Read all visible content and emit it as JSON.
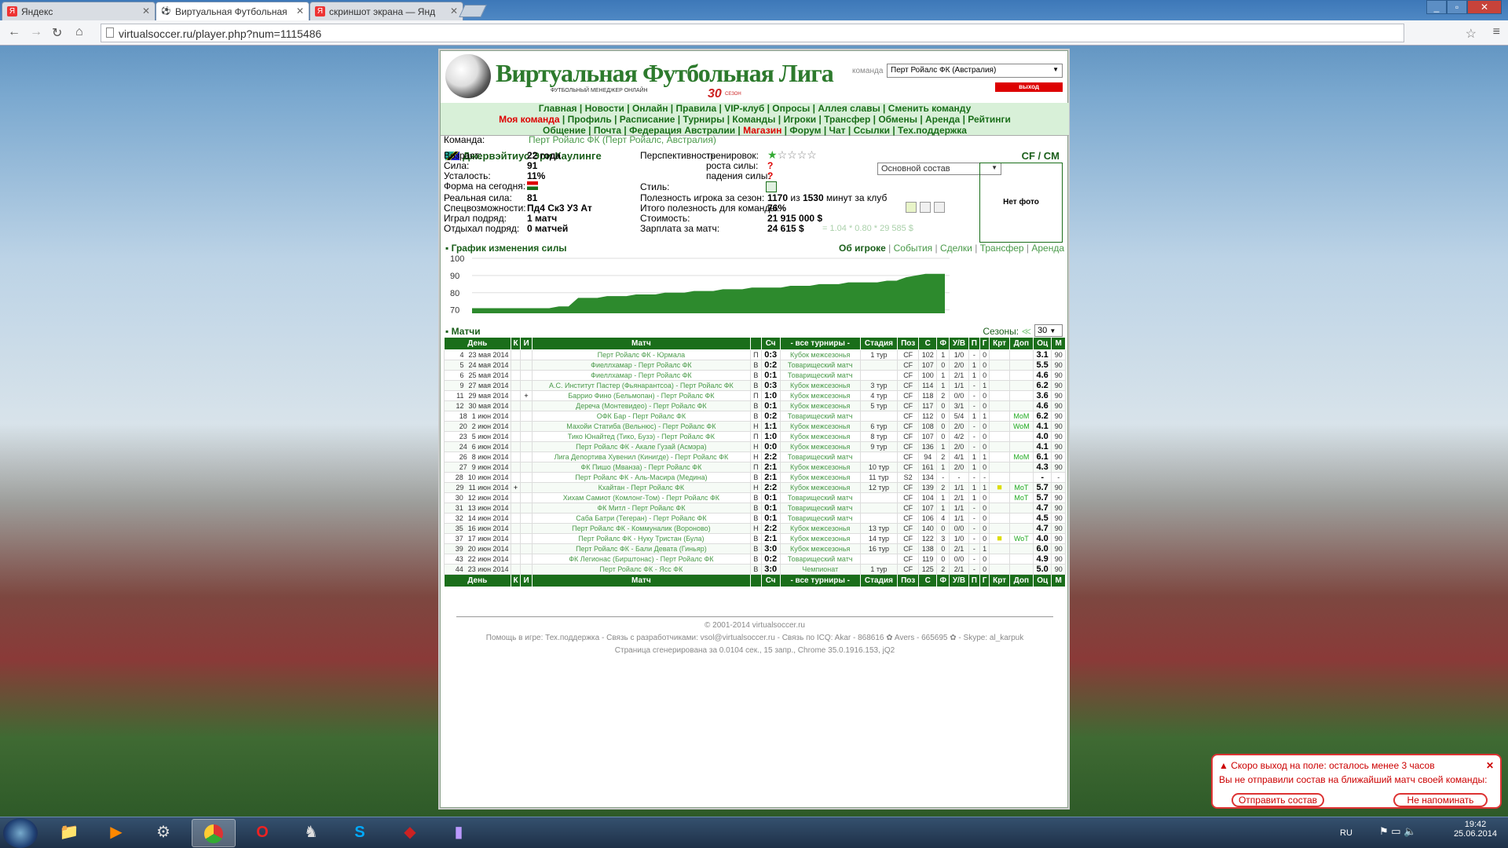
{
  "browser": {
    "tabs": [
      {
        "title": "Яндекс",
        "fav": "Я"
      },
      {
        "title": "Виртуальная Футбольная",
        "fav": "⚽"
      },
      {
        "title": "скриншот экрана — Янд",
        "fav": "Я"
      }
    ],
    "url": "virtualsoccer.ru/player.php?num=1115486"
  },
  "site": {
    "name": "Виртуальная Футбольная Лига",
    "tagline": "ФУТБОЛЬНЫЙ МЕНЕДЖЕР ОНЛАЙН",
    "season": "30",
    "season_label": "СЕЗОН",
    "team_label": "команда",
    "team_value": "Перт Ройалс ФК (Австралия)",
    "logout": "выход"
  },
  "nav": {
    "row1": [
      "Главная",
      "Новости",
      "Онлайн",
      "Правила",
      "VIP-клуб",
      "Опросы",
      "Аллея славы",
      "Сменить команду"
    ],
    "row2": [
      "Моя команда",
      "Профиль",
      "Расписание",
      "Турниры",
      "Команды",
      "Игроки",
      "Трансфер",
      "Обмены",
      "Аренда",
      "Рейтинги"
    ],
    "row3": [
      "Общение",
      "Почта",
      "Федерация Австралии",
      "Магазин",
      "Форум",
      "Чат",
      "Ссылки",
      "Тех.поддержка"
    ]
  },
  "player": {
    "name": "Джервэйтиус Эри Каулинге",
    "position": "CF / CM",
    "team_label": "Команда:",
    "team": "Перт Ройалс ФК (Перт Ройалс, Австралия)",
    "squad": "Основной состав",
    "photo": "Нет фото",
    "age_l": "Возраст:",
    "age": "22 года",
    "power_l": "Сила:",
    "power": "91",
    "fatigue_l": "Усталость:",
    "fatigue": "11%",
    "form_l": "Форма на сегодня:",
    "real_l": "Реальная сила:",
    "real": "81",
    "spec_l": "Спецвозможности:",
    "spec": "Пд4 Ск3 У3 Ат",
    "streak_l": "Играл подряд:",
    "streak": "1 матч",
    "rest_l": "Отдыхал подряд:",
    "rest": "0 матчей",
    "persp_l": "Перспективность",
    "train_l": "тренировок:",
    "grow_l": "роста силы:",
    "fall_l": "падения силы:",
    "train_stars": 1,
    "style_l": "Стиль:",
    "useful_l": "Полезность игрока за сезон:",
    "useful_a": "1170",
    "useful_b": "из",
    "useful_c": "1530",
    "useful_d": "минут за клуб",
    "team_use_l": "Итого полезность для команды:",
    "team_use": "76%",
    "cost_l": "Стоимость:",
    "cost": "21 915 000 $",
    "salary_l": "Зарплата за матч:",
    "salary": "24 615 $",
    "salary_calc": "= 1.04 * 0.80 * 29 585 $"
  },
  "chart_section": {
    "title": "График изменения силы",
    "links": [
      "Об игроке",
      "События",
      "Сделки",
      "Трансфер",
      "Аренда"
    ]
  },
  "chart_data": {
    "type": "area",
    "title": "График изменения силы",
    "yticks": [
      100,
      90,
      80,
      70
    ],
    "ylim": [
      68,
      100
    ],
    "x": [
      0,
      1,
      2,
      3,
      4,
      5,
      6,
      7,
      8,
      9,
      10,
      11,
      12,
      13,
      14,
      15,
      16,
      17,
      18,
      19,
      20,
      21,
      22,
      23,
      24,
      25,
      26,
      27,
      28,
      29,
      30,
      31,
      32,
      33,
      34,
      35,
      36,
      37,
      38,
      39,
      40,
      41,
      42,
      43,
      44,
      45,
      46,
      47,
      48,
      49
    ],
    "values": [
      71,
      71,
      71,
      71,
      71,
      71,
      71,
      71,
      71,
      72,
      72,
      77,
      77,
      77,
      78,
      78,
      78,
      79,
      79,
      79,
      80,
      80,
      80,
      81,
      81,
      81,
      82,
      82,
      82,
      83,
      83,
      83,
      83,
      84,
      84,
      84,
      85,
      85,
      85,
      86,
      86,
      86,
      86,
      87,
      87,
      89,
      90,
      91,
      91,
      91
    ],
    "color": "#2d8a2d"
  },
  "matches_section": {
    "title": "Матчи",
    "seasons_label": "Сезоны:",
    "season": "30"
  },
  "table": {
    "headers": [
      "День",
      "К",
      "И",
      "Матч",
      "",
      "Сч",
      "- все турниры -",
      "Стадия",
      "Поз",
      "С",
      "Ф",
      "У/В",
      "П",
      "Г",
      "Крт",
      "Доп",
      "Оц",
      "М"
    ],
    "rows": [
      [
        "4",
        "23 мая 2014",
        "",
        "",
        "Перт Ройалс ФК - Юрмала",
        "П",
        "0:3",
        "Кубок межсезонья",
        "1 тур",
        "CF",
        "102",
        "1",
        "1/0",
        "-",
        "0",
        "",
        "",
        "3.1",
        "90"
      ],
      [
        "5",
        "24 мая 2014",
        "",
        "",
        "Фиеллхамар - Перт Ройалс ФК",
        "В",
        "0:2",
        "Товарищеский матч",
        "",
        "CF",
        "107",
        "0",
        "2/0",
        "1",
        "0",
        "",
        "",
        "5.5",
        "90"
      ],
      [
        "6",
        "25 мая 2014",
        "",
        "",
        "Фиеллхамар - Перт Ройалс ФК",
        "В",
        "0:1",
        "Товарищеский матч",
        "",
        "CF",
        "100",
        "1",
        "2/1",
        "1",
        "0",
        "",
        "",
        "4.6",
        "90"
      ],
      [
        "9",
        "27 мая 2014",
        "",
        "",
        "А.С. Институт Пастер (Фьянарантсоа) - Перт Ройалс ФК",
        "В",
        "0:3",
        "Кубок межсезонья",
        "3 тур",
        "CF",
        "114",
        "1",
        "1/1",
        "-",
        "1",
        "",
        "",
        "6.2",
        "90"
      ],
      [
        "11",
        "29 мая 2014",
        "",
        "+",
        "Баррио Фино (Бельмопан) - Перт Ройалс ФК",
        "П",
        "1:0",
        "Кубок межсезонья",
        "4 тур",
        "CF",
        "118",
        "2",
        "0/0",
        "-",
        "0",
        "",
        "",
        "3.6",
        "90"
      ],
      [
        "12",
        "30 мая 2014",
        "",
        "",
        "Дереча (Монтевидео) - Перт Ройалс ФК",
        "В",
        "0:1",
        "Кубок межсезонья",
        "5 тур",
        "CF",
        "117",
        "0",
        "3/1",
        "-",
        "0",
        "",
        "",
        "4.6",
        "90"
      ],
      [
        "18",
        "1 июн 2014",
        "",
        "",
        "ОФК Бар - Перт Ройалс ФК",
        "В",
        "0:2",
        "Товарищеский матч",
        "",
        "CF",
        "112",
        "0",
        "5/4",
        "1",
        "1",
        "",
        "МоМ",
        "6.2",
        "90"
      ],
      [
        "20",
        "2 июн 2014",
        "",
        "",
        "Махойи Статиба (Вельнюс) - Перт Ройалс ФК",
        "Н",
        "1:1",
        "Кубок межсезонья",
        "6 тур",
        "CF",
        "108",
        "0",
        "2/0",
        "-",
        "0",
        "",
        "WoM",
        "4.1",
        "90"
      ],
      [
        "23",
        "5 июн 2014",
        "",
        "",
        "Тико Юнайтед (Тико, Бузэ) - Перт Ройалс ФК",
        "П",
        "1:0",
        "Кубок межсезонья",
        "8 тур",
        "CF",
        "107",
        "0",
        "4/2",
        "-",
        "0",
        "",
        "",
        "4.0",
        "90"
      ],
      [
        "24",
        "6 июн 2014",
        "",
        "",
        "Перт Ройалс ФК - Акале Гузай (Асмэра)",
        "Н",
        "0:0",
        "Кубок межсезонья",
        "9 тур",
        "CF",
        "136",
        "1",
        "2/0",
        "-",
        "0",
        "",
        "",
        "4.1",
        "90"
      ],
      [
        "26",
        "8 июн 2014",
        "",
        "",
        "Лига Депортива Хувенил (Кинигде) - Перт Ройалс ФК",
        "Н",
        "2:2",
        "Товарищеский матч",
        "",
        "CF",
        "94",
        "2",
        "4/1",
        "1",
        "1",
        "",
        "МоМ",
        "6.1",
        "90"
      ],
      [
        "27",
        "9 июн 2014",
        "",
        "",
        "ФК Пишо (Мванза) - Перт Ройалс ФК",
        "П",
        "2:1",
        "Кубок межсезонья",
        "10 тур",
        "CF",
        "161",
        "1",
        "2/0",
        "1",
        "0",
        "",
        "",
        "4.3",
        "90"
      ],
      [
        "28",
        "10 июн 2014",
        "",
        "",
        "Перт Ройалс ФК - Аль-Масира (Медина)",
        "В",
        "2:1",
        "Кубок межсезонья",
        "11 тур",
        "S2",
        "134",
        "-",
        "-",
        "-",
        "-",
        "",
        "",
        "-",
        "-"
      ],
      [
        "29",
        "11 июн 2014",
        "+",
        "",
        "Кхайтан - Перт Ройалс ФК",
        "Н",
        "2:2",
        "Кубок межсезонья",
        "12 тур",
        "CF",
        "139",
        "2",
        "1/1",
        "1",
        "1",
        "■",
        "МоТ",
        "5.7",
        "90"
      ],
      [
        "30",
        "12 июн 2014",
        "",
        "",
        "Хихам Самиот (Комлонг-Том) - Перт Ройалс ФК",
        "В",
        "0:1",
        "Товарищеский матч",
        "",
        "CF",
        "104",
        "1",
        "2/1",
        "1",
        "0",
        "",
        "МоТ",
        "5.7",
        "90"
      ],
      [
        "31",
        "13 июн 2014",
        "",
        "",
        "ФК Митл - Перт Ройалс ФК",
        "В",
        "0:1",
        "Товарищеский матч",
        "",
        "CF",
        "107",
        "1",
        "1/1",
        "-",
        "0",
        "",
        "",
        "4.7",
        "90"
      ],
      [
        "32",
        "14 июн 2014",
        "",
        "",
        "Саба Батри (Тегеран) - Перт Ройалс ФК",
        "В",
        "0:1",
        "Товарищеский матч",
        "",
        "CF",
        "106",
        "4",
        "1/1",
        "-",
        "0",
        "",
        "",
        "4.5",
        "90"
      ],
      [
        "35",
        "16 июн 2014",
        "",
        "",
        "Перт Ройалс ФК - Коммуналик (Вороново)",
        "Н",
        "2:2",
        "Кубок межсезонья",
        "13 тур",
        "CF",
        "140",
        "0",
        "0/0",
        "-",
        "0",
        "",
        "",
        "4.7",
        "90"
      ],
      [
        "37",
        "17 июн 2014",
        "",
        "",
        "Перт Ройалс ФК - Нуку Тристан (Була)",
        "В",
        "2:1",
        "Кубок межсезонья",
        "14 тур",
        "CF",
        "122",
        "3",
        "1/0",
        "-",
        "0",
        "■",
        "WoT",
        "4.0",
        "90"
      ],
      [
        "39",
        "20 июн 2014",
        "",
        "",
        "Перт Ройалс ФК - Бали Девата (Гиньяр)",
        "В",
        "3:0",
        "Кубок межсезонья",
        "16 тур",
        "CF",
        "138",
        "0",
        "2/1",
        "-",
        "1",
        "",
        "",
        "6.0",
        "90"
      ],
      [
        "43",
        "22 июн 2014",
        "",
        "",
        "ФК Легионас (Бирштонас) - Перт Ройалс ФК",
        "В",
        "0:2",
        "Товарищеский матч",
        "",
        "CF",
        "119",
        "0",
        "0/0",
        "-",
        "0",
        "",
        "",
        "4.9",
        "90"
      ],
      [
        "44",
        "23 июн 2014",
        "",
        "",
        "Перт Ройалс ФК - Ясс ФК",
        "В",
        "3:0",
        "Чемпионат",
        "1 тур",
        "CF",
        "125",
        "2",
        "2/1",
        "-",
        "0",
        "",
        "",
        "5.0",
        "90"
      ]
    ]
  },
  "footer": {
    "copy": "© 2001-2014 virtualsoccer.ru",
    "help": "Помощь в игре: Тех.поддержка - Связь с разработчиками: vsol@virtualsoccer.ru - Связь по ICQ: Akar - 868616 ✿ Avers - 665695 ✿ - Skype: al_karpuk",
    "gen": "Страница сгенерирована за 0.0104 сек., 15 запр., Chrome 35.0.1916.153, jQ2"
  },
  "notification": {
    "title": "Скоро выход на поле: осталось менее 3 часов",
    "message": "Вы не отправили состав на ближайший матч своей команды:",
    "send": "Отправить состав",
    "dismiss": "Не напоминать"
  },
  "tray": {
    "lang": "RU",
    "time": "19:42",
    "date": "25.06.2014"
  }
}
